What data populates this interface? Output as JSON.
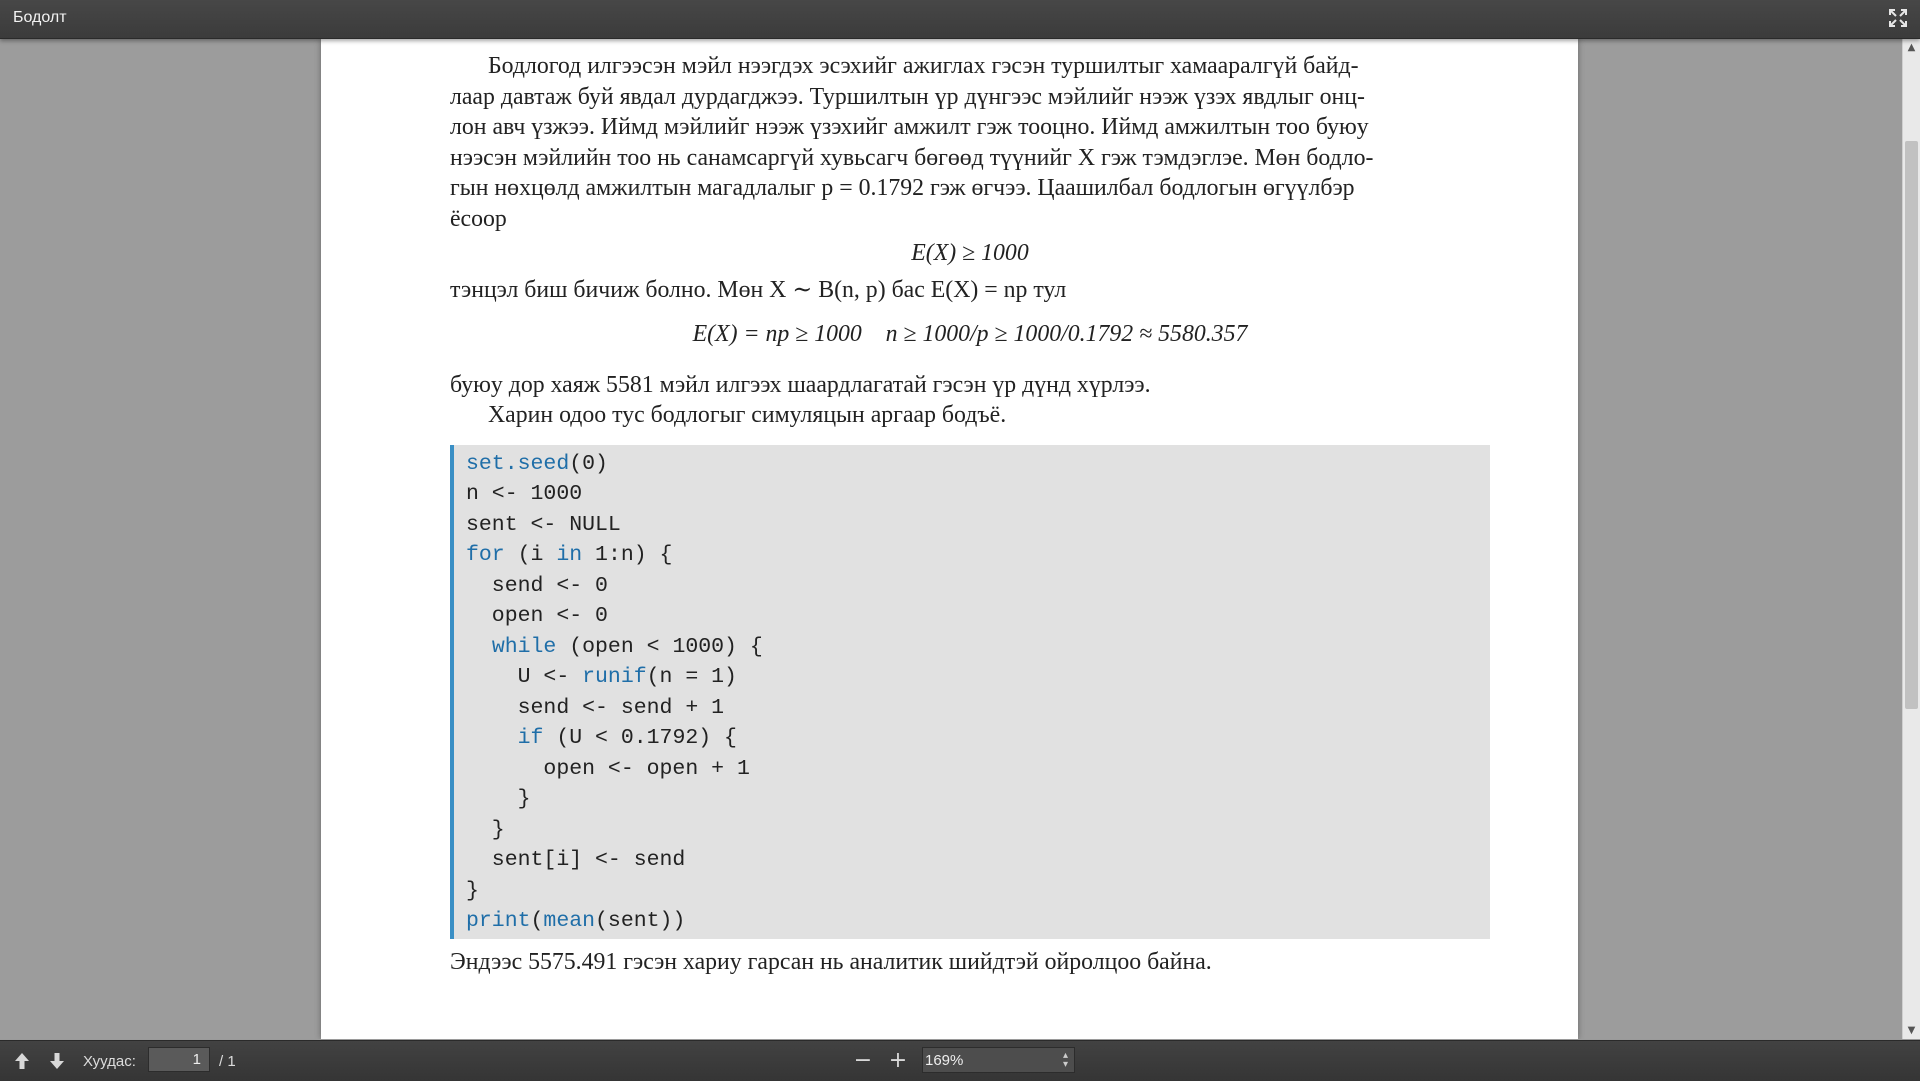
{
  "window": {
    "title": "Бодолт"
  },
  "document": {
    "para1_lines": [
      "Бодлогод илгээсэн мэйл нээгдэх эсэхийг ажиглах гэсэн туршилтыг хамааралгүй байд-",
      "лаар давтаж буй явдал дурдагджээ. Туршилтын үр дүнгээс мэйлийг нээж үзэх явдлыг онц-",
      "лон авч үзжээ. Иймд мэйлийг нээж үзэхийг амжилт гэж тооцно. Иймд амжилтын тоо буюу",
      "нээсэн мэйлийн тоо нь санамсаргүй хувьсагч бөгөөд түүнийг X гэж тэмдэглэе. Мөн бодло-",
      "гын нөхцөлд амжилтын магадлалыг p = 0.1792 гэж өгчээ. Цаашилбал бодлогын өгүүлбэр",
      "ёсоор"
    ],
    "eq1": "E(X) ≥ 1000",
    "para2": "тэнцэл биш бичиж болно. Мөн X ∼ B(n, p) бас E(X) = np тул",
    "eq2": "E(X) = np ≥ 1000    n ≥ 1000/p ≥ 1000/0.1792 ≈ 5580.357",
    "para3": "буюу дор хаяж 5581 мэйл илгээх шаардлагатай гэсэн үр дүнд хүрлээ.",
    "para4": "Харин одоо тус бодлогыг симуляцын аргаар бодъё.",
    "code": {
      "l1_kw": "set.seed",
      "l1_rest": "(0)",
      "l2": "n <- 1000",
      "l3": "sent <- NULL",
      "l4_kw1": "for",
      "l4_mid": " (i ",
      "l4_kw2": "in",
      "l4_rest": " 1:n) {",
      "l5": "  send <- 0",
      "l6": "  open <- 0",
      "l7_indent": "  ",
      "l7_kw": "while",
      "l7_rest": " (open < 1000) {",
      "l8_pre": "    U <- ",
      "l8_kw": "runif",
      "l8_rest": "(n = 1)",
      "l9": "    send <- send + 1",
      "l10_indent": "    ",
      "l10_kw": "if",
      "l10_rest": " (U < 0.1792) {",
      "l11": "      open <- open + 1",
      "l12": "    }",
      "l13": "  }",
      "l14": "  sent[i] <- send",
      "l15": "}",
      "l16_kw1": "print",
      "l16_mid": "(",
      "l16_kw2": "mean",
      "l16_rest": "(sent))"
    },
    "para5": "Эндээс 5575.491 гэсэн хариу гарсан нь аналитик шийдтэй ойролцоо байна."
  },
  "toolbar": {
    "page_label": "Хуудас:",
    "page_value": "1",
    "page_total": "/ 1",
    "zoom_value": "169%",
    "zoom_out": "−",
    "zoom_in": "+"
  },
  "colors": {
    "code_keyword": "#1f6ea8",
    "code_border": "#3a8fc5"
  }
}
